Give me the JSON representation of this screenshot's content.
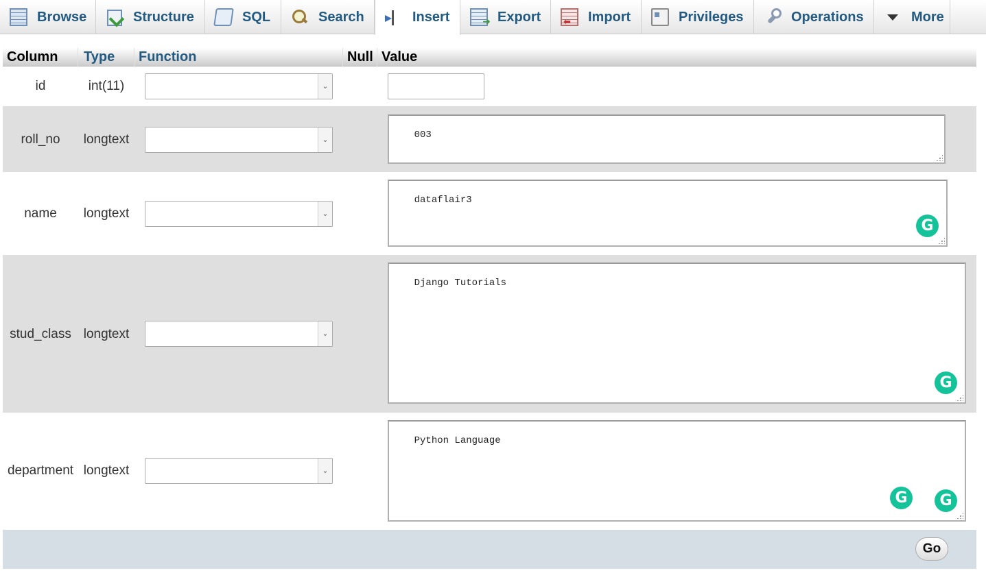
{
  "tabs": [
    {
      "label": "Browse",
      "icon": "browse-icon"
    },
    {
      "label": "Structure",
      "icon": "structure-icon"
    },
    {
      "label": "SQL",
      "icon": "sql-icon"
    },
    {
      "label": "Search",
      "icon": "search-icon"
    },
    {
      "label": "Insert",
      "icon": "insert-icon",
      "active": true
    },
    {
      "label": "Export",
      "icon": "export-icon"
    },
    {
      "label": "Import",
      "icon": "import-icon"
    },
    {
      "label": "Privileges",
      "icon": "privileges-icon"
    },
    {
      "label": "Operations",
      "icon": "operations-icon"
    },
    {
      "label": "More",
      "icon": "dropdown-arrow-icon"
    }
  ],
  "table": {
    "headers": {
      "column": "Column",
      "type": "Type",
      "function": "Function",
      "null": "Null",
      "value": "Value"
    },
    "rows": [
      {
        "column": "id",
        "type": "int(11)",
        "function": "",
        "value": ""
      },
      {
        "column": "roll_no",
        "type": "longtext",
        "function": "",
        "value": "003"
      },
      {
        "column": "name",
        "type": "longtext",
        "function": "",
        "value": "dataflair3"
      },
      {
        "column": "stud_class",
        "type": "longtext",
        "function": "",
        "value": "Django Tutorials"
      },
      {
        "column": "department",
        "type": "longtext",
        "function": "",
        "value": "Python Language"
      }
    ]
  },
  "grammarly_badge": "G",
  "footer": {
    "go_label": "Go"
  },
  "colors": {
    "link": "#235a81",
    "row_alt": "#dfdfdf",
    "footer_bg": "#d5dde5",
    "grammarly": "#15c39a"
  }
}
